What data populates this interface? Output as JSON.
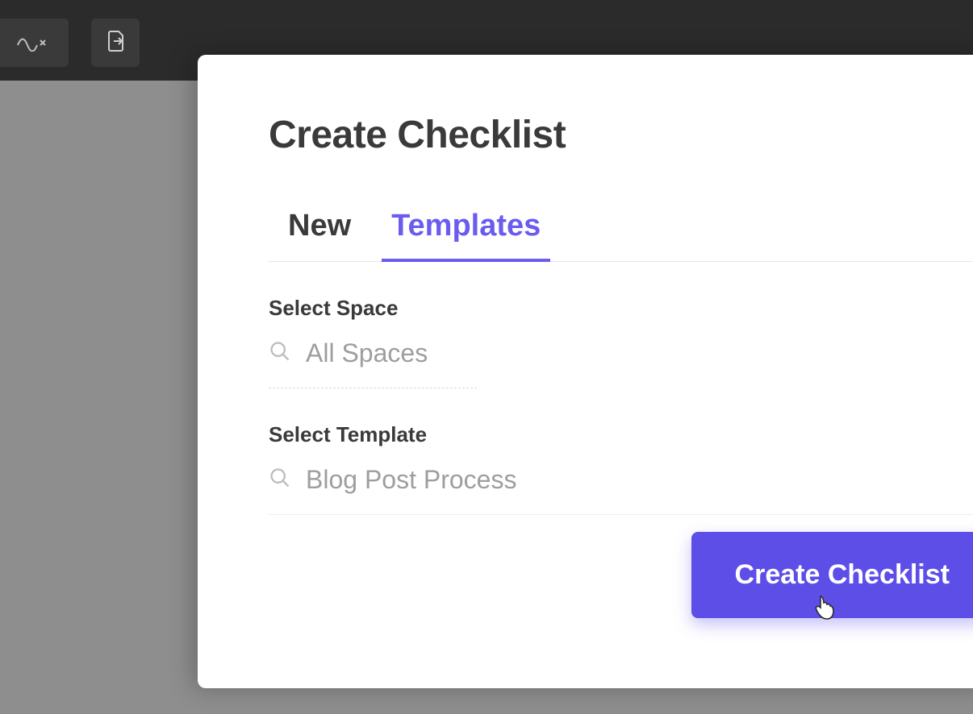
{
  "modal": {
    "title": "Create Checklist",
    "tabs": {
      "new": "New",
      "templates": "Templates"
    },
    "space": {
      "label": "Select Space",
      "value": "All Spaces"
    },
    "template": {
      "label": "Select Template",
      "value": "Blog Post Process"
    },
    "submit_label": "Create Checklist"
  }
}
